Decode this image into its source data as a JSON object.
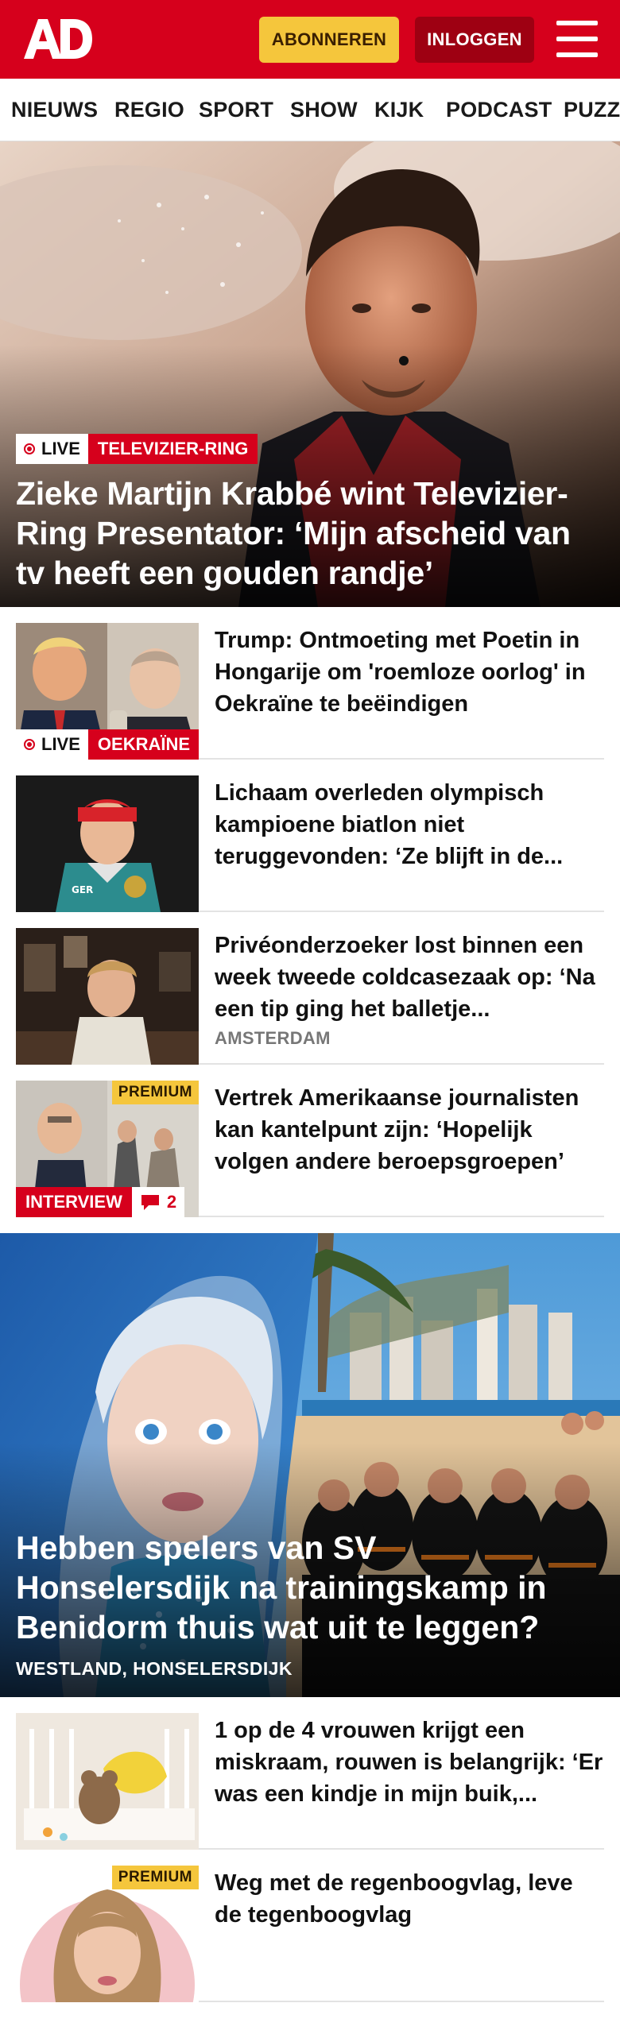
{
  "header": {
    "logo_text": "AD",
    "subscribe_label": "ABONNEREN",
    "login_label": "INLOGGEN",
    "menu_icon": "hamburger-menu-icon",
    "brand_color": "#d6001c"
  },
  "nav": {
    "items": [
      "NIEUWS",
      "REGIO",
      "SPORT",
      "SHOW",
      "KIJK",
      "PODCAST",
      "PUZZ"
    ]
  },
  "hero": {
    "live_label": "LIVE",
    "tag": "TELEVIZIER-RING",
    "title": "Zieke Martijn Krabbé wint Televizier-Ring Presentator: ‘Mijn afscheid van tv heeft een gouden randje’"
  },
  "articles": [
    {
      "title": "Trump: Ontmoeting met Poetin in Hongarije om 'roemloze oorlog' in Oekraïne te beëindigen",
      "live_label": "LIVE",
      "tag": "OEKRAÏNE"
    },
    {
      "title": "Lichaam overleden olympisch kampioene biatlon niet teruggevonden: ‘Ze blijft in de..."
    },
    {
      "title": "Privéonderzoeker lost binnen een week tweede coldcasezaak op: ‘Na een tip ging het balletje...",
      "location": "AMSTERDAM"
    },
    {
      "title": "Vertrek Amerikaanse journalisten kan kantelpunt zijn: ‘Hopelijk volgen andere beroepsgroepen’",
      "premium_label": "PREMIUM",
      "tag": "INTERVIEW",
      "comment_count": "2"
    }
  ],
  "feature": {
    "title": "Hebben spelers van SV Honselersdijk na trainingskamp in Benidorm thuis wat uit te leggen?",
    "location": "WESTLAND, HONSELERSDIJK"
  },
  "articles2": [
    {
      "title": "1 op de 4 vrouwen krijgt een miskraam, rouwen is belangrijk: ‘Er was een kindje in mijn buik,..."
    },
    {
      "title": "Weg met de regenboogvlag, leve de tegenboogvlag",
      "premium_label": "PREMIUM"
    }
  ]
}
